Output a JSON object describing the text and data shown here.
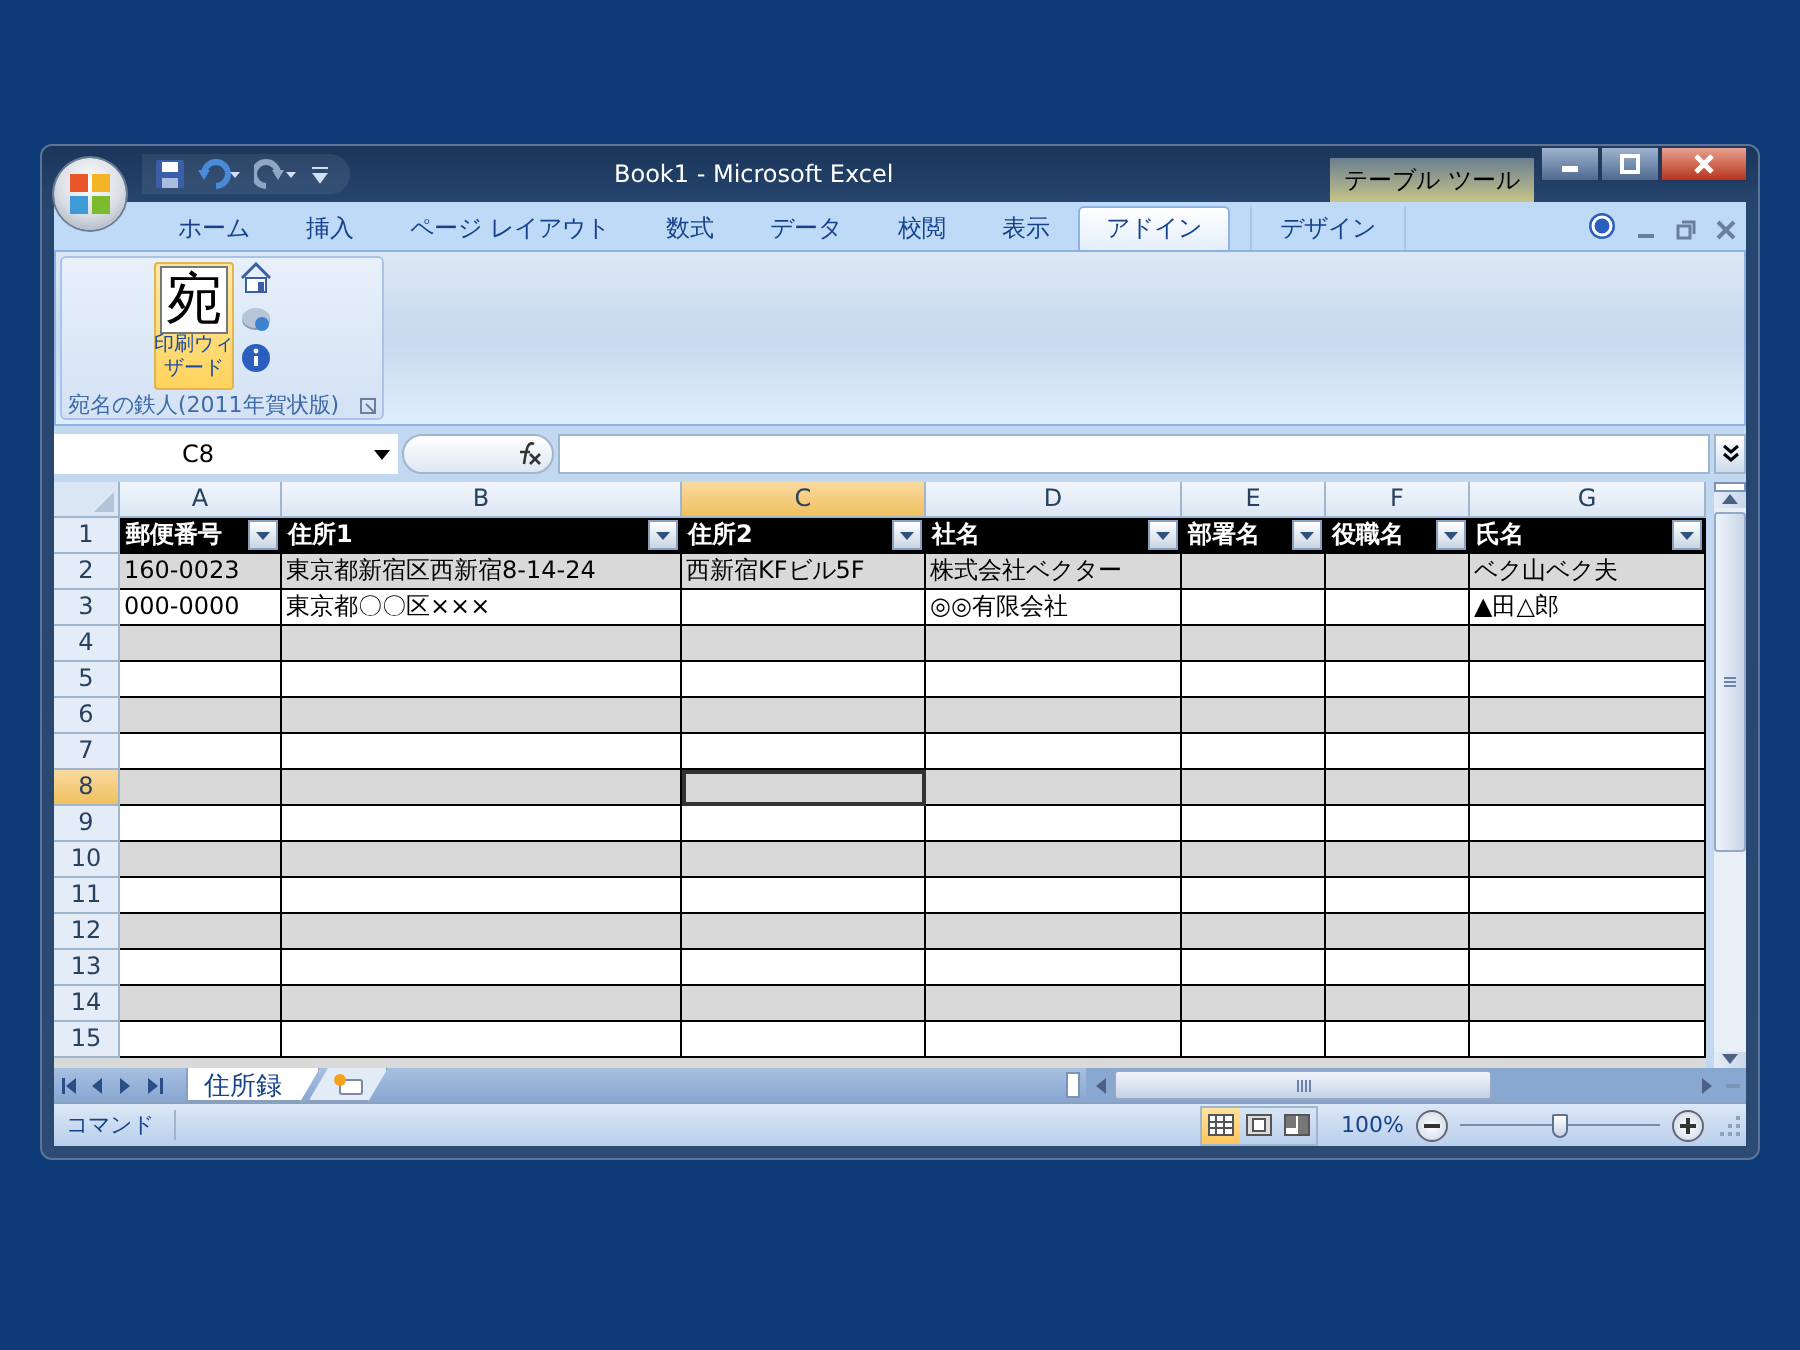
{
  "window": {
    "title": "Book1 - Microsoft Excel",
    "contextual_tab_group": "テーブル ツール"
  },
  "ribbon_tabs": [
    {
      "label": "ホーム",
      "selected": false,
      "kind": "normal"
    },
    {
      "label": "挿入",
      "selected": false,
      "kind": "normal"
    },
    {
      "label": "ページ レイアウト",
      "selected": false,
      "kind": "normal"
    },
    {
      "label": "数式",
      "selected": false,
      "kind": "normal"
    },
    {
      "label": "データ",
      "selected": false,
      "kind": "normal"
    },
    {
      "label": "校閲",
      "selected": false,
      "kind": "normal"
    },
    {
      "label": "表示",
      "selected": false,
      "kind": "normal"
    },
    {
      "label": "アドイン",
      "selected": true,
      "kind": "normal"
    },
    {
      "label": "デザイン",
      "selected": false,
      "kind": "contextual"
    }
  ],
  "ribbon_group": {
    "title": "宛名の鉄人(2011年賀状版)",
    "big_button": {
      "glyph": "宛",
      "label": "印刷ウィザード"
    }
  },
  "formula_bar": {
    "name_box": "C8"
  },
  "columns": [
    {
      "letter": "A",
      "selected": false
    },
    {
      "letter": "B",
      "selected": false
    },
    {
      "letter": "C",
      "selected": true
    },
    {
      "letter": "D",
      "selected": false
    },
    {
      "letter": "E",
      "selected": false
    },
    {
      "letter": "F",
      "selected": false
    },
    {
      "letter": "G",
      "selected": false
    }
  ],
  "rows": [
    {
      "number": "1",
      "kind": "header",
      "selected": false,
      "cells": [
        "郵便番号",
        "住所1",
        "住所2",
        "社名",
        "部署名",
        "役職名",
        "氏名"
      ]
    },
    {
      "number": "2",
      "kind": "data",
      "selected": false,
      "cells": [
        "160-0023",
        "東京都新宿区西新宿8-14-24",
        "西新宿KFビル5F",
        "株式会社ベクター",
        null,
        null,
        "ベク山ベク夫"
      ]
    },
    {
      "number": "3",
      "kind": "data",
      "selected": false,
      "cells": [
        "000-0000",
        "東京都〇〇区×××",
        null,
        "◎◎有限会社",
        null,
        null,
        "▲田△郎"
      ]
    },
    {
      "number": "4",
      "kind": "data",
      "selected": false,
      "cells": []
    },
    {
      "number": "5",
      "kind": "data",
      "selected": false,
      "cells": []
    },
    {
      "number": "6",
      "kind": "data",
      "selected": false,
      "cells": []
    },
    {
      "number": "7",
      "kind": "data",
      "selected": false,
      "cells": []
    },
    {
      "number": "8",
      "kind": "data",
      "selected": true,
      "cells": []
    },
    {
      "number": "9",
      "kind": "data",
      "selected": false,
      "cells": []
    },
    {
      "number": "10",
      "kind": "data",
      "selected": false,
      "cells": []
    },
    {
      "number": "11",
      "kind": "data",
      "selected": false,
      "cells": []
    },
    {
      "number": "12",
      "kind": "data",
      "selected": false,
      "cells": []
    },
    {
      "number": "13",
      "kind": "data",
      "selected": false,
      "cells": []
    },
    {
      "number": "14",
      "kind": "data",
      "selected": false,
      "cells": []
    },
    {
      "number": "15",
      "kind": "data",
      "selected": false,
      "cells": []
    }
  ],
  "sheet_tabs": [
    {
      "label": "住所録",
      "selected": true
    }
  ],
  "status_bar": {
    "mode": "コマンド",
    "view_buttons": [
      {
        "kind": "normal",
        "selected": true
      },
      {
        "kind": "page_layout",
        "selected": false
      },
      {
        "kind": "page_break",
        "selected": false
      }
    ],
    "zoom": {
      "label": "100%",
      "level": 0.5
    }
  }
}
